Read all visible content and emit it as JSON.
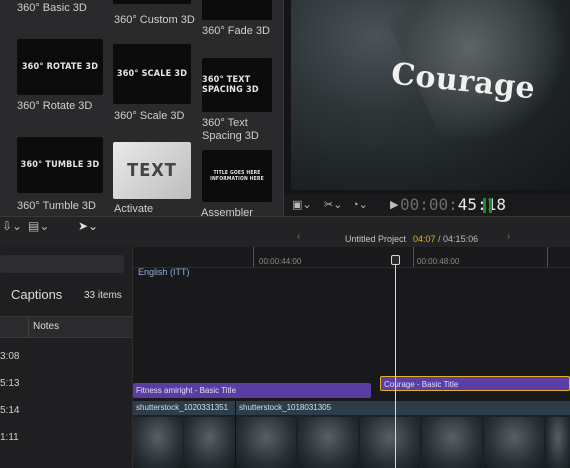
{
  "browser": {
    "tiles": [
      {
        "label": "360° Basic 3D",
        "thumb": ""
      },
      {
        "label": "360° Custom 3D",
        "thumb": ""
      },
      {
        "label": "360° Fade 3D",
        "thumb": ""
      },
      {
        "label": "360° Rotate 3D",
        "thumb": "360° ROTATE 3D"
      },
      {
        "label": "360° Scale 3D",
        "thumb": "360° SCALE 3D"
      },
      {
        "label": "360° Text Spacing 3D",
        "thumb": "360° TEXT SPACING 3D"
      },
      {
        "label": "360° Tumble 3D",
        "thumb": "360° TUMBLE 3D"
      },
      {
        "label": "Activate",
        "thumb": "TEXT"
      },
      {
        "label": "Assembler",
        "thumb": "TITLE GOES HERE INFORMATION HERE"
      }
    ]
  },
  "viewer": {
    "title_text": "Courage",
    "timecode_dim": "00:00:",
    "timecode": "45:18",
    "colors": {
      "meter": "#1d8a2e"
    }
  },
  "timeline_header": {
    "project": "Untitled Project",
    "current": "04:07",
    "duration": "/ 04:15:06"
  },
  "index": {
    "title": "Captions",
    "count": "33 items",
    "column": "Notes",
    "times": [
      "3:08",
      "5:13",
      "5:14",
      "1:11"
    ]
  },
  "timeline": {
    "language": "English (ITT)",
    "ruler": [
      "00:00:44:00",
      "00:00:48:00"
    ],
    "clips": {
      "title_a": "Fitness amiright - Basic Title",
      "title_b": "Courage - Basic Title",
      "video_1": "shutterstock_1020331351",
      "video_2": "shutterstock_1018031305"
    },
    "colors": {
      "title": "#5a3da0",
      "selected": "#e6b127"
    }
  }
}
